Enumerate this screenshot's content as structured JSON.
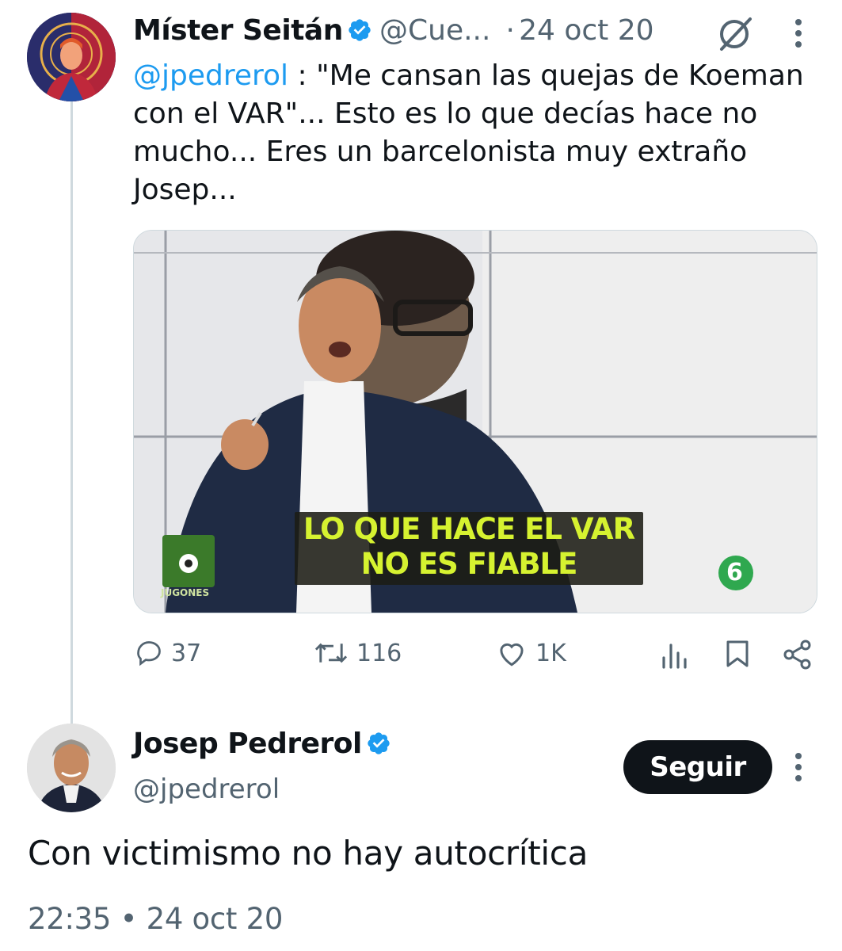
{
  "quoted_tweet": {
    "author_name": "Míster Seitán",
    "author_handle": "@Cue...",
    "separator": "·",
    "date": "24 oct 20",
    "mention": "@jpedrerol",
    "text": " : \"Me cansan las quejas de Koeman con el VAR\"... Esto es lo que decías hace no mucho... Eres un barcelonista muy extraño Josep...",
    "media": {
      "caption_line1": "LO QUE HACE EL VAR",
      "caption_line2": "NO ES FIABLE",
      "show_logo_text": "JUGONES",
      "channel_logo": "6"
    },
    "actions": {
      "replies": "37",
      "retweets": "116",
      "likes": "1K"
    }
  },
  "reply_tweet": {
    "author_name": "Josep Pedrerol",
    "author_handle": "@jpedrerol",
    "follow_label": "Seguir",
    "text": "Con victimismo no hay autocrítica",
    "time": "22:35",
    "separator": "•",
    "date": "24 oct 20"
  },
  "colors": {
    "accent": "#1d9bf0",
    "muted": "#536471",
    "caption_text": "#d6f230"
  }
}
